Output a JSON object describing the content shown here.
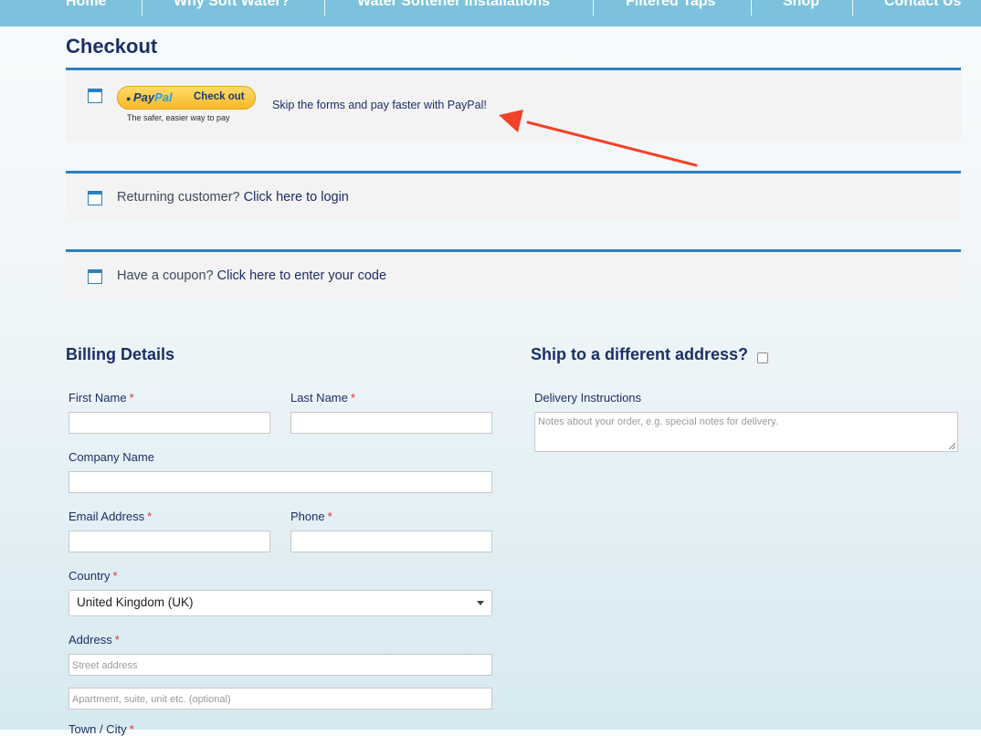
{
  "nav": {
    "items": [
      "Home",
      "Why Soft Water?",
      "Water Softener Installations",
      "Filtered Taps",
      "Shop",
      "Contact Us"
    ]
  },
  "page": {
    "title": "Checkout"
  },
  "paypal": {
    "logo_pay": "Pay",
    "logo_pal": "Pal",
    "checkout_label": "Check out",
    "tagline": "The safer, easier way to pay",
    "skip_text": "Skip the forms and pay faster with PayPal!"
  },
  "login_notice": {
    "prefix": "Returning customer?",
    "link": "Click here to login"
  },
  "coupon_notice": {
    "prefix": "Have a coupon?",
    "link": "Click here to enter your code"
  },
  "billing": {
    "heading": "Billing Details",
    "required_mark": "*",
    "first_name": {
      "label": "First Name",
      "value": ""
    },
    "last_name": {
      "label": "Last Name",
      "value": ""
    },
    "company": {
      "label": "Company Name",
      "value": ""
    },
    "email": {
      "label": "Email Address",
      "value": ""
    },
    "phone": {
      "label": "Phone",
      "value": ""
    },
    "country": {
      "label": "Country",
      "value": "United Kingdom (UK)"
    },
    "address": {
      "label": "Address",
      "street_placeholder": "Street address",
      "apartment_placeholder": "Apartment, suite, unit etc. (optional)"
    },
    "town": {
      "label": "Town / City"
    }
  },
  "shipping": {
    "heading": "Ship to a different address?",
    "checked": false,
    "delivery": {
      "label": "Delivery Instructions",
      "placeholder": "Notes about your order, e.g. special notes for delivery."
    }
  },
  "colors": {
    "nav_bg": "#7cc2dc",
    "accent_blue": "#2b81bf",
    "heading_navy": "#1c2f66",
    "required_red": "#e0322f",
    "annotation_arrow": "#f0432a",
    "paypal_yellow": "#f7b928"
  }
}
